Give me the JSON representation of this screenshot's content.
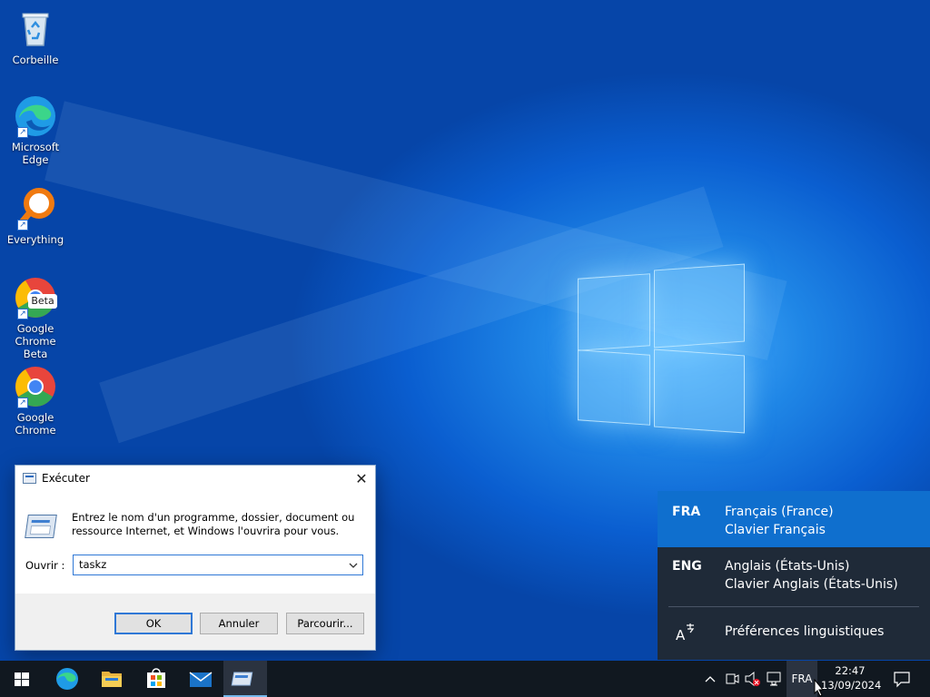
{
  "desktop": {
    "icons": [
      {
        "label": "Corbeille",
        "icon": "recycle-bin-icon"
      },
      {
        "label": "Microsoft Edge",
        "icon": "edge-icon"
      },
      {
        "label": "Everything",
        "icon": "everything-search-icon"
      },
      {
        "label": "Google Chrome Beta",
        "icon": "chrome-beta-icon",
        "badge": "Beta"
      },
      {
        "label": "Google Chrome",
        "icon": "chrome-icon"
      }
    ]
  },
  "run_dialog": {
    "title": "Exécuter",
    "close_glyph": "✕",
    "description": "Entrez le nom d'un programme, dossier, document ou ressource Internet, et Windows l'ouvrira pour vous.",
    "open_label": "Ouvrir :",
    "input_value": "taskz",
    "buttons": {
      "ok": "OK",
      "cancel": "Annuler",
      "browse": "Parcourir..."
    }
  },
  "language_flyout": {
    "options": [
      {
        "code": "FRA",
        "name": "Français (France)",
        "keyboard": "Clavier Français",
        "selected": true
      },
      {
        "code": "ENG",
        "name": "Anglais (États-Unis)",
        "keyboard": "Clavier Anglais (États-Unis)",
        "selected": false
      }
    ],
    "preferences_label": "Préférences linguistiques"
  },
  "taskbar": {
    "apps": [
      "start-icon",
      "edge-icon",
      "file-explorer-icon",
      "store-icon",
      "mail-icon",
      "run-icon"
    ],
    "input_indicator": "FRA",
    "time": "22:47",
    "date": "13/09/2024"
  },
  "colors": {
    "accent": "#0f6fce",
    "taskbar": "#111820",
    "flyout": "#1f2a38"
  }
}
